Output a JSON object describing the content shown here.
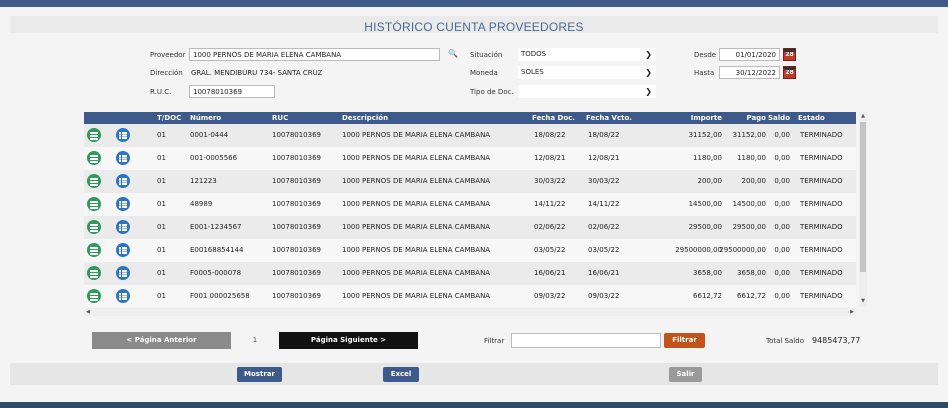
{
  "title": "HISTÓRICO CUENTA PROVEEDORES",
  "form": {
    "proveedor_label": "Proveedor",
    "proveedor_value": "1000 PERNOS DE MARIA ELENA CAMBANA",
    "direccion_label": "Dirección",
    "direccion_value": "GRAL. MENDIBURU 734- SANTA CRUZ",
    "ruc_label": "R.U.C.",
    "ruc_value": "10078010369",
    "situacion_label": "Situación",
    "situacion_value": "TODOS",
    "moneda_label": "Moneda",
    "moneda_value": "SOLES",
    "tipo_doc_label": "Tipo de Doc.",
    "tipo_doc_value": "",
    "desde_label": "Desde",
    "desde_value": "01/01/2020",
    "hasta_label": "Hasta",
    "hasta_value": "30/12/2022",
    "calendar_text": "28"
  },
  "table": {
    "columns": [
      "T/DOC",
      "Número",
      "RUC",
      "Descripción",
      "Fecha Doc.",
      "Fecha Vcto.",
      "Importe",
      "Pago",
      "Saldo",
      "Estado"
    ],
    "rows": [
      {
        "tdoc": "01",
        "numero": "0001-0444",
        "ruc": "10078010369",
        "descripcion": "1000 PERNOS DE MARIA ELENA CAMBANA",
        "fecha_doc": "18/08/22",
        "fecha_vcto": "18/08/22",
        "importe": "31152,00",
        "pago": "31152,00",
        "saldo": "0,00",
        "estado": "TERMINADO"
      },
      {
        "tdoc": "01",
        "numero": "001-0005566",
        "ruc": "10078010369",
        "descripcion": "1000 PERNOS DE MARIA ELENA CAMBANA",
        "fecha_doc": "12/08/21",
        "fecha_vcto": "12/08/21",
        "importe": "1180,00",
        "pago": "1180,00",
        "saldo": "0,00",
        "estado": "TERMINADO"
      },
      {
        "tdoc": "01",
        "numero": "121223",
        "ruc": "10078010369",
        "descripcion": "1000 PERNOS DE MARIA ELENA CAMBANA",
        "fecha_doc": "30/03/22",
        "fecha_vcto": "30/03/22",
        "importe": "200,00",
        "pago": "200,00",
        "saldo": "0,00",
        "estado": "TERMINADO"
      },
      {
        "tdoc": "01",
        "numero": "48989",
        "ruc": "10078010369",
        "descripcion": "1000 PERNOS DE MARIA ELENA CAMBANA",
        "fecha_doc": "14/11/22",
        "fecha_vcto": "14/11/22",
        "importe": "14500,00",
        "pago": "14500,00",
        "saldo": "0,00",
        "estado": "TERMINADO"
      },
      {
        "tdoc": "01",
        "numero": "E001-1234567",
        "ruc": "10078010369",
        "descripcion": "1000 PERNOS DE MARIA ELENA CAMBANA",
        "fecha_doc": "02/06/22",
        "fecha_vcto": "02/06/22",
        "importe": "29500,00",
        "pago": "29500,00",
        "saldo": "0,00",
        "estado": "TERMINADO"
      },
      {
        "tdoc": "01",
        "numero": "E00168854144",
        "ruc": "10078010369",
        "descripcion": "1000 PERNOS DE MARIA ELENA CAMBANA",
        "fecha_doc": "03/05/22",
        "fecha_vcto": "03/05/22",
        "importe": "29500000,00",
        "pago": "29500000,00",
        "saldo": "0,00",
        "estado": "TERMINADO"
      },
      {
        "tdoc": "01",
        "numero": "F0005-000078",
        "ruc": "10078010369",
        "descripcion": "1000 PERNOS DE MARIA ELENA CAMBANA",
        "fecha_doc": "16/06/21",
        "fecha_vcto": "16/06/21",
        "importe": "3658,00",
        "pago": "3658,00",
        "saldo": "0,00",
        "estado": "TERMINADO"
      },
      {
        "tdoc": "01",
        "numero": "F001 000025658",
        "ruc": "10078010369",
        "descripcion": "1000 PERNOS DE MARIA ELENA CAMBANA",
        "fecha_doc": "09/03/22",
        "fecha_vcto": "09/03/22",
        "importe": "6612,72",
        "pago": "6612,72",
        "saldo": "0,00",
        "estado": "TERMINADO"
      }
    ]
  },
  "pager": {
    "prev_label": "< Página Anterior",
    "page_number": "1",
    "next_label": "Página Siguiente >",
    "filter_label": "Filtrar",
    "filter_value": "",
    "filter_button": "Filtrar",
    "total_label": "Total Saldo",
    "total_value": "9485473,77"
  },
  "footer": {
    "mostrar_label": "Mostrar",
    "excel_label": "Excel",
    "salir_label": "Salir"
  },
  "colors": {
    "header_bg": "#3e5a8a",
    "title_text": "#4a6a94",
    "icon_green": "#2e9a5c",
    "icon_blue": "#2d74c5",
    "filter_button": "#c0541a",
    "next_button": "#111111",
    "prev_button": "#8a8a8a"
  }
}
